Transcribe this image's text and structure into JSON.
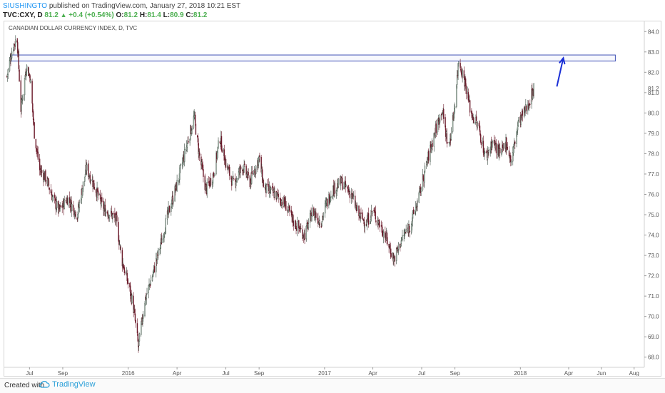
{
  "header": {
    "author": "SIUSHINGTO",
    "published_text": "published on TradingView.com, January 27, 2018 10:21 EST",
    "symbol": "TVC:CXY, D",
    "last": "81.2",
    "change": "+0.4 (+0.54%)",
    "open_label": "O:",
    "open": "81.2",
    "high_label": "H:",
    "high": "81.4",
    "low_label": "L:",
    "low": "80.9",
    "close_label": "C:",
    "close": "81.2"
  },
  "footer": {
    "created_with": "Created with",
    "brand": "TradingView"
  },
  "chart_data": {
    "type": "candlestick",
    "title": "CANADIAN DOLLAR CURRENCY INDEX, D, TVC",
    "ylim": [
      67.5,
      84.5
    ],
    "y_ticks": [
      "84.0",
      "83.0",
      "82.0",
      "81.0",
      "80.0",
      "79.0",
      "78.0",
      "77.0",
      "76.0",
      "75.0",
      "74.0",
      "73.0",
      "72.0",
      "71.0",
      "70.0",
      "69.0",
      "68.0"
    ],
    "last_price_label": "81.2",
    "x_ticks": [
      "Jul",
      "Sep",
      "2016",
      "Apr",
      "Jul",
      "Sep",
      "2017",
      "Apr",
      "Jul",
      "Sep",
      "2018",
      "Apr",
      "Jun",
      "Aug"
    ],
    "x_tick_dates": [
      "2015-07-01",
      "2015-09-01",
      "2016-01-01",
      "2016-04-01",
      "2016-07-01",
      "2016-09-01",
      "2017-01-01",
      "2017-04-01",
      "2017-07-01",
      "2017-09-01",
      "2018-01-01",
      "2018-04-01",
      "2018-06-01",
      "2018-08-01"
    ],
    "resistance_zone": {
      "from": "2015-05-27",
      "to": "2018-06-27",
      "low": 82.55,
      "high": 82.85
    },
    "arrow": {
      "from_date": "2018-03-10",
      "from_value": 81.3,
      "to_date": "2018-03-22",
      "to_value": 82.7
    },
    "price_path": [
      {
        "date": "2015-05-20",
        "close": 81.8
      },
      {
        "date": "2015-05-30",
        "close": 83.2
      },
      {
        "date": "2015-06-08",
        "close": 83.7
      },
      {
        "date": "2015-06-15",
        "close": 80.2
      },
      {
        "date": "2015-06-25",
        "close": 82.3
      },
      {
        "date": "2015-07-02",
        "close": 81.8
      },
      {
        "date": "2015-07-10",
        "close": 79.0
      },
      {
        "date": "2015-07-20",
        "close": 77.2
      },
      {
        "date": "2015-08-01",
        "close": 76.8
      },
      {
        "date": "2015-08-15",
        "close": 75.7
      },
      {
        "date": "2015-08-25",
        "close": 75.2
      },
      {
        "date": "2015-09-10",
        "close": 75.8
      },
      {
        "date": "2015-09-28",
        "close": 75.0
      },
      {
        "date": "2015-10-15",
        "close": 77.3
      },
      {
        "date": "2015-11-01",
        "close": 76.3
      },
      {
        "date": "2015-11-15",
        "close": 75.3
      },
      {
        "date": "2015-12-01",
        "close": 75.0
      },
      {
        "date": "2015-12-10",
        "close": 74.7
      },
      {
        "date": "2015-12-20",
        "close": 72.8
      },
      {
        "date": "2016-01-01",
        "close": 71.6
      },
      {
        "date": "2016-01-10",
        "close": 70.6
      },
      {
        "date": "2016-01-20",
        "close": 68.5
      },
      {
        "date": "2016-02-01",
        "close": 70.8
      },
      {
        "date": "2016-02-15",
        "close": 72.0
      },
      {
        "date": "2016-03-01",
        "close": 73.5
      },
      {
        "date": "2016-03-15",
        "close": 75.0
      },
      {
        "date": "2016-04-01",
        "close": 76.5
      },
      {
        "date": "2016-04-20",
        "close": 78.5
      },
      {
        "date": "2016-05-03",
        "close": 79.8
      },
      {
        "date": "2016-05-12",
        "close": 78.0
      },
      {
        "date": "2016-05-25",
        "close": 76.2
      },
      {
        "date": "2016-06-08",
        "close": 77.0
      },
      {
        "date": "2016-06-20",
        "close": 78.8
      },
      {
        "date": "2016-07-01",
        "close": 77.5
      },
      {
        "date": "2016-07-15",
        "close": 76.5
      },
      {
        "date": "2016-08-01",
        "close": 77.4
      },
      {
        "date": "2016-08-15",
        "close": 76.6
      },
      {
        "date": "2016-09-01",
        "close": 77.8
      },
      {
        "date": "2016-09-10",
        "close": 76.3
      },
      {
        "date": "2016-10-01",
        "close": 76.0
      },
      {
        "date": "2016-10-20",
        "close": 75.5
      },
      {
        "date": "2016-11-05",
        "close": 74.6
      },
      {
        "date": "2016-11-25",
        "close": 74.0
      },
      {
        "date": "2016-12-10",
        "close": 75.2
      },
      {
        "date": "2016-12-25",
        "close": 74.6
      },
      {
        "date": "2017-01-01",
        "close": 75.3
      },
      {
        "date": "2017-01-15",
        "close": 76.2
      },
      {
        "date": "2017-02-01",
        "close": 76.6
      },
      {
        "date": "2017-02-20",
        "close": 76.0
      },
      {
        "date": "2017-03-05",
        "close": 75.0
      },
      {
        "date": "2017-03-20",
        "close": 74.6
      },
      {
        "date": "2017-04-01",
        "close": 75.2
      },
      {
        "date": "2017-04-20",
        "close": 74.2
      },
      {
        "date": "2017-05-01",
        "close": 73.5
      },
      {
        "date": "2017-05-10",
        "close": 72.8
      },
      {
        "date": "2017-05-25",
        "close": 73.8
      },
      {
        "date": "2017-06-10",
        "close": 74.5
      },
      {
        "date": "2017-06-25",
        "close": 75.8
      },
      {
        "date": "2017-07-10",
        "close": 77.5
      },
      {
        "date": "2017-07-25",
        "close": 79.0
      },
      {
        "date": "2017-08-08",
        "close": 80.2
      },
      {
        "date": "2017-08-20",
        "close": 78.2
      },
      {
        "date": "2017-08-30",
        "close": 80.0
      },
      {
        "date": "2017-09-08",
        "close": 82.6
      },
      {
        "date": "2017-09-20",
        "close": 81.5
      },
      {
        "date": "2017-10-01",
        "close": 80.0
      },
      {
        "date": "2017-10-15",
        "close": 79.3
      },
      {
        "date": "2017-10-28",
        "close": 77.8
      },
      {
        "date": "2017-11-10",
        "close": 78.6
      },
      {
        "date": "2017-11-25",
        "close": 77.9
      },
      {
        "date": "2017-12-05",
        "close": 78.6
      },
      {
        "date": "2017-12-15",
        "close": 77.6
      },
      {
        "date": "2017-12-28",
        "close": 79.5
      },
      {
        "date": "2018-01-08",
        "close": 80.0
      },
      {
        "date": "2018-01-18",
        "close": 80.6
      },
      {
        "date": "2018-01-26",
        "close": 81.2
      }
    ]
  }
}
